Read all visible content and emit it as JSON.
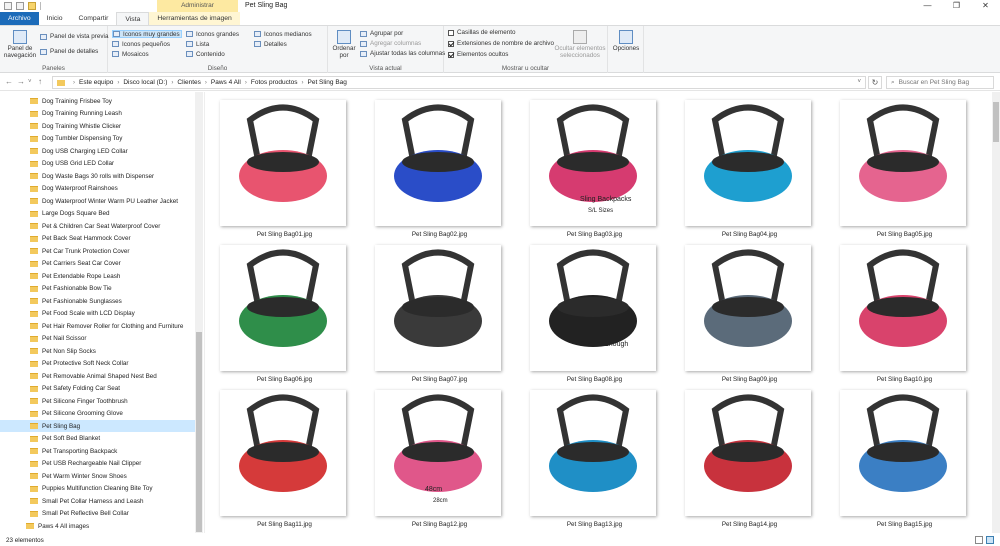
{
  "window": {
    "title": "Pet Sling Bag",
    "contextual_tab_group": "Administrar",
    "controls": [
      "—",
      "❐",
      "✕"
    ]
  },
  "ribbon_tabs": [
    {
      "label": "Archivo",
      "kind": "file"
    },
    {
      "label": "Inicio",
      "kind": "normal"
    },
    {
      "label": "Compartir",
      "kind": "normal"
    },
    {
      "label": "Vista",
      "kind": "active"
    },
    {
      "label": "Herramientas de imagen",
      "kind": "tools"
    }
  ],
  "ribbon": {
    "panes": {
      "label": "Paneles",
      "navigation_pane": "Panel de navegación",
      "preview_pane": "Panel de vista previa",
      "details_pane": "Panel de detalles"
    },
    "layout": {
      "label": "Diseño",
      "options": [
        {
          "label": "Iconos muy grandes",
          "selected": true
        },
        {
          "label": "Iconos grandes",
          "selected": false
        },
        {
          "label": "Iconos medianos",
          "selected": false
        },
        {
          "label": "Iconos pequeños",
          "selected": false
        },
        {
          "label": "Lista",
          "selected": false
        },
        {
          "label": "Detalles",
          "selected": false
        },
        {
          "label": "Mosaicos",
          "selected": false
        },
        {
          "label": "Contenido",
          "selected": false
        }
      ]
    },
    "current_view": {
      "label": "Vista actual",
      "sort_by": "Ordenar por",
      "group_by": "Agrupar por",
      "add_columns": "Agregar columnas",
      "size_columns": "Ajustar todas las columnas"
    },
    "show_hide": {
      "label": "Mostrar u ocultar",
      "checkboxes": [
        {
          "label": "Casillas de elemento",
          "checked": false
        },
        {
          "label": "Extensiones de nombre de archivo",
          "checked": true
        },
        {
          "label": "Elementos ocultos",
          "checked": true
        }
      ],
      "hide_selected": "Ocultar elementos seleccionados"
    },
    "options": {
      "label": "Opciones"
    }
  },
  "address": {
    "crumbs": [
      "Este equipo",
      "Disco local (D:)",
      "Clientes",
      "Paws 4 All",
      "Fotos productos",
      "Pet Sling Bag"
    ],
    "search_placeholder": "Buscar en Pet Sling Bag"
  },
  "nav_items": [
    {
      "label": "Dog Training Frisbee Toy"
    },
    {
      "label": "Dog Training Running Leash"
    },
    {
      "label": "Dog Training Whistle Clicker"
    },
    {
      "label": "Dog Tumbler Dispensing Toy"
    },
    {
      "label": "Dog USB Charging LED Collar"
    },
    {
      "label": "Dog USB Grid LED Collar"
    },
    {
      "label": "Dog Waste Bags 30 rolls with Dispenser"
    },
    {
      "label": "Dog Waterproof Rainshoes"
    },
    {
      "label": "Dog Waterproof Winter Warm PU Leather Jacket"
    },
    {
      "label": "Large Dogs Square Bed"
    },
    {
      "label": "Pet & Children Car Seat Waterproof Cover"
    },
    {
      "label": "Pet Back Seat Hammock Cover"
    },
    {
      "label": "Pet Car Trunk Protection Cover"
    },
    {
      "label": "Pet Carriers Seat Car Cover"
    },
    {
      "label": "Pet Extendable Rope Leash"
    },
    {
      "label": "Pet Fashionable Bow Tie"
    },
    {
      "label": "Pet Fashionable Sunglasses"
    },
    {
      "label": "Pet Food Scale with LCD Display"
    },
    {
      "label": "Pet Hair Remover Roller for Clothing and Furniture"
    },
    {
      "label": "Pet Nail Scissor"
    },
    {
      "label": "Pet Non Slip Socks"
    },
    {
      "label": "Pet Protective Soft Neck Collar"
    },
    {
      "label": "Pet Removable Animal Shaped Nest Bed"
    },
    {
      "label": "Pet Safety Folding Car Seat"
    },
    {
      "label": "Pet Silicone Finger Toothbrush"
    },
    {
      "label": "Pet Silicone Grooming Glove"
    },
    {
      "label": "Pet Sling Bag",
      "selected": true
    },
    {
      "label": "Pet Soft Bed Blanket"
    },
    {
      "label": "Pet Transporting Backpack"
    },
    {
      "label": "Pet USB Rechargeable Nail Clipper"
    },
    {
      "label": "Pet Warm Winter Snow Shoes"
    },
    {
      "label": "Puppies Multifunction Cleaning Bite Toy"
    },
    {
      "label": "Small Pet Collar Harness and Leash"
    },
    {
      "label": "Small Pet Reflective Bell Collar"
    },
    {
      "label": "Paws 4 All images",
      "parent": true
    }
  ],
  "files": [
    {
      "name": "Pet Sling Bag01.jpg",
      "accent": "#e8546f",
      "bg": "#ffffff"
    },
    {
      "name": "Pet Sling Bag02.jpg",
      "accent": "#2a4dc8",
      "bg": "#ffffff"
    },
    {
      "name": "Pet Sling Bag03.jpg",
      "accent": "#d63b70",
      "bg": "#ffffff",
      "caption": "Sling Backpacks",
      "caption2": "S/L Sizes"
    },
    {
      "name": "Pet Sling Bag04.jpg",
      "accent": "#1e9fd0",
      "bg": "#ffffff"
    },
    {
      "name": "Pet Sling Bag05.jpg",
      "accent": "#e5648f",
      "bg": "#ffffff"
    },
    {
      "name": "Pet Sling Bag06.jpg",
      "accent": "#2f8e4a",
      "bg": "#ffffff"
    },
    {
      "name": "Pet Sling Bag07.jpg",
      "accent": "#3a3a3a",
      "bg": "#ffffff"
    },
    {
      "name": "Pet Sling Bag08.jpg",
      "accent": "#222222",
      "bg": "#ffffff",
      "caption": "Secure Enough"
    },
    {
      "name": "Pet Sling Bag09.jpg",
      "accent": "#5b6b7a",
      "bg": "#ffffff"
    },
    {
      "name": "Pet Sling Bag10.jpg",
      "accent": "#d9436c",
      "bg": "#ffffff"
    },
    {
      "name": "Pet Sling Bag11.jpg",
      "accent": "#d53a3a",
      "bg": "#ffffff"
    },
    {
      "name": "Pet Sling Bag12.jpg",
      "accent": "#e0578a",
      "bg": "#ffffff",
      "caption": "48cm",
      "caption2": "28cm"
    },
    {
      "name": "Pet Sling Bag13.jpg",
      "accent": "#1f8fc6",
      "bg": "#ffffff"
    },
    {
      "name": "Pet Sling Bag14.jpg",
      "accent": "#c8323d",
      "bg": "#ffffff"
    },
    {
      "name": "Pet Sling Bag15.jpg",
      "accent": "#3b7fc4",
      "bg": "#ffffff"
    }
  ],
  "status": {
    "count": "23 elementos"
  }
}
